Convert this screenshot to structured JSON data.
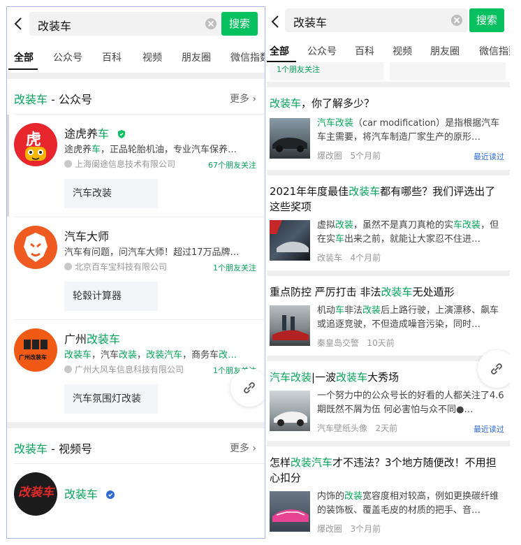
{
  "search": {
    "query": "改装车",
    "button": "搜索"
  },
  "tabs": [
    "全部",
    "公众号",
    "百科",
    "视频",
    "朋友圈",
    "微信指数"
  ],
  "left": {
    "gzh_section": {
      "keyword": "改装车",
      "suffix": " - 公众号",
      "more": "更多"
    },
    "accounts": [
      {
        "name_pre": "途虎养",
        "name_hl": "车",
        "desc_pre": "途虎养",
        "desc_hl": "车",
        "desc_post": "，正品轮胎机油，专业汽车保养…",
        "org": "上海阑途信息技术有限公司",
        "friends": "67个朋友关注",
        "chip": "汽车改装",
        "avatar_text": "虎"
      },
      {
        "name": "汽车大师",
        "desc": "汽车有问题，问汽车大师！超过17万品牌…",
        "org": "北京百车宝科技有限公司",
        "friends": "1个朋友关注",
        "chip": "轮毂计算器"
      },
      {
        "name_pre": "广州",
        "name_hl": "改装车",
        "desc_a": "改装车",
        "desc_b": "，汽车",
        "desc_c": "改装",
        "desc_d": "，",
        "desc_e": "改装",
        "desc_f": "汽车",
        "desc_g": "，商务车",
        "desc_h": "改…",
        "org": "广州大风车信息科技有限公司",
        "friends": "1个朋友关注",
        "chip": "汽车氛围灯改装",
        "avatar_text": "广州改装车"
      }
    ],
    "video_section": {
      "keyword": "改装车",
      "suffix": " - 视频号",
      "more": "更多"
    },
    "channel": {
      "name": "改装车",
      "avatar_text": "改装车"
    }
  },
  "right": {
    "strip_friends": "1个朋友关注",
    "articles": [
      {
        "t1": "改装车",
        "t2": "，你了解多少？",
        "s1": "汽车改装",
        "s2": "（car modification）是指根据汽车车主需要，将汽车制造厂家生产的原形…",
        "src": "爆改圈",
        "time": "5个月前",
        "tag": "最近读过"
      },
      {
        "t1": "2021年年度最佳",
        "t2": "改装车",
        "t3": "都有哪些？我们评选出了这些奖项",
        "s1": "虚拟",
        "s2": "改装",
        "s3": "，虽然不是真刀真枪的实",
        "s4": "车改装",
        "s5": "，但在实",
        "s6": "车",
        "s7": "出来之前，就能让大家忍不住进…",
        "src": "改装车",
        "time": "4个月前"
      },
      {
        "t1": "重点防控 严厉打击 非法",
        "t2": "改装车",
        "t3": "无处遁形",
        "s1": "机动",
        "s2": "车",
        "s3": "非法",
        "s4": "改装",
        "s5": "后上路行驶，上演漂移、飙车或追逐竞驶，不但造成噪音污染，同时…",
        "src": "秦皇岛交警",
        "time": "10天前"
      },
      {
        "t1": "汽车改装",
        "t2": "|一波",
        "t3": "改装车",
        "t4": "大秀场",
        "s1": "一个努力中的公众号长的好看的人都关注了4.6期既然不屑为伍 何必害怕与众不同●…",
        "src": "汽车壁纸头像",
        "time": "2天前",
        "tag": "最近读过"
      },
      {
        "t1": "怎样",
        "t2": "改装汽车",
        "t3": "才不违法？3个地方随便改！不用担心扣分",
        "s1": "内饰的",
        "s2": "改装",
        "s3": "宽容度相对较高，例如更换碳纤维的装饰板、覆盖毛皮的材质的把手、音…",
        "src": "爆改圈",
        "time": "3个月前"
      }
    ]
  },
  "colors": {
    "accent": "#07c160",
    "highlight": "#07a35a",
    "link_blue": "#2f6bd6"
  }
}
